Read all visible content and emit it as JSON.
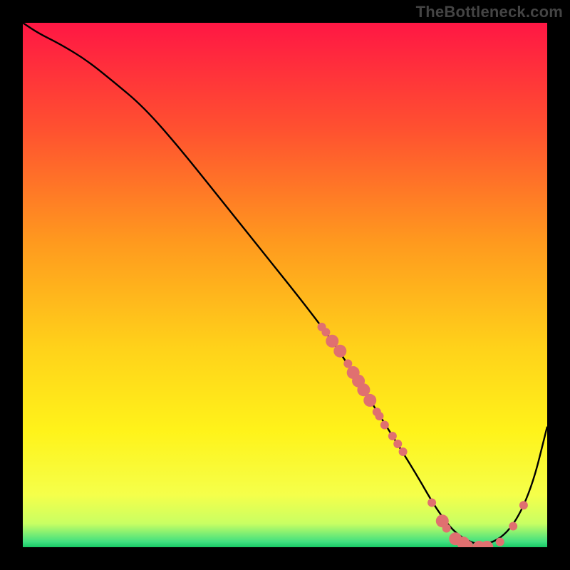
{
  "watermark": "TheBottleneck.com",
  "chart_data": {
    "type": "line",
    "title": "",
    "xlabel": "",
    "ylabel": "",
    "xlim": [
      0,
      100
    ],
    "ylim": [
      0,
      100
    ],
    "grid": false,
    "legend": false,
    "gradient_stops": [
      {
        "offset": 0.0,
        "color": "#ff1744"
      },
      {
        "offset": 0.2,
        "color": "#ff5030"
      },
      {
        "offset": 0.42,
        "color": "#ff9a1e"
      },
      {
        "offset": 0.62,
        "color": "#ffd21a"
      },
      {
        "offset": 0.78,
        "color": "#fff31a"
      },
      {
        "offset": 0.9,
        "color": "#f5ff4a"
      },
      {
        "offset": 0.955,
        "color": "#c9ff63"
      },
      {
        "offset": 0.99,
        "color": "#40e080"
      },
      {
        "offset": 1.0,
        "color": "#18c864"
      }
    ],
    "series": [
      {
        "name": "bottleneck-curve",
        "x": [
          0,
          3,
          7,
          12,
          17,
          23,
          30,
          38,
          46,
          54,
          60,
          65,
          70,
          75,
          79,
          83,
          88,
          93,
          97,
          100
        ],
        "y": [
          100,
          98,
          96,
          93,
          89,
          84,
          76,
          66,
          56,
          46,
          38,
          30,
          22,
          14,
          7,
          2,
          0,
          3,
          11,
          23
        ]
      }
    ],
    "markers": {
      "name": "highlight-points",
      "color": "#e07070",
      "radius_small": 6,
      "radius_large": 9,
      "points": [
        {
          "x": 57.0,
          "y": 42.0,
          "r": "s"
        },
        {
          "x": 57.8,
          "y": 41.0,
          "r": "s"
        },
        {
          "x": 59.0,
          "y": 39.3,
          "r": "l"
        },
        {
          "x": 60.5,
          "y": 37.4,
          "r": "l"
        },
        {
          "x": 62.0,
          "y": 35.0,
          "r": "s"
        },
        {
          "x": 63.0,
          "y": 33.3,
          "r": "l"
        },
        {
          "x": 64.0,
          "y": 31.7,
          "r": "l"
        },
        {
          "x": 65.0,
          "y": 30.0,
          "r": "l"
        },
        {
          "x": 66.2,
          "y": 28.0,
          "r": "l"
        },
        {
          "x": 67.5,
          "y": 25.8,
          "r": "s"
        },
        {
          "x": 68.0,
          "y": 25.0,
          "r": "s"
        },
        {
          "x": 69.0,
          "y": 23.3,
          "r": "s"
        },
        {
          "x": 70.5,
          "y": 21.2,
          "r": "s"
        },
        {
          "x": 71.5,
          "y": 19.7,
          "r": "s"
        },
        {
          "x": 72.5,
          "y": 18.2,
          "r": "s"
        },
        {
          "x": 78.0,
          "y": 8.5,
          "r": "s"
        },
        {
          "x": 80.0,
          "y": 5.0,
          "r": "l"
        },
        {
          "x": 80.8,
          "y": 3.6,
          "r": "s"
        },
        {
          "x": 82.5,
          "y": 1.6,
          "r": "l"
        },
        {
          "x": 84.0,
          "y": 0.8,
          "r": "l"
        },
        {
          "x": 85.0,
          "y": 0.4,
          "r": "s"
        },
        {
          "x": 87.0,
          "y": 0.0,
          "r": "l"
        },
        {
          "x": 88.5,
          "y": 0.0,
          "r": "l"
        },
        {
          "x": 91.0,
          "y": 1.0,
          "r": "s"
        },
        {
          "x": 93.5,
          "y": 4.0,
          "r": "s"
        },
        {
          "x": 95.5,
          "y": 8.0,
          "r": "s"
        }
      ]
    }
  }
}
